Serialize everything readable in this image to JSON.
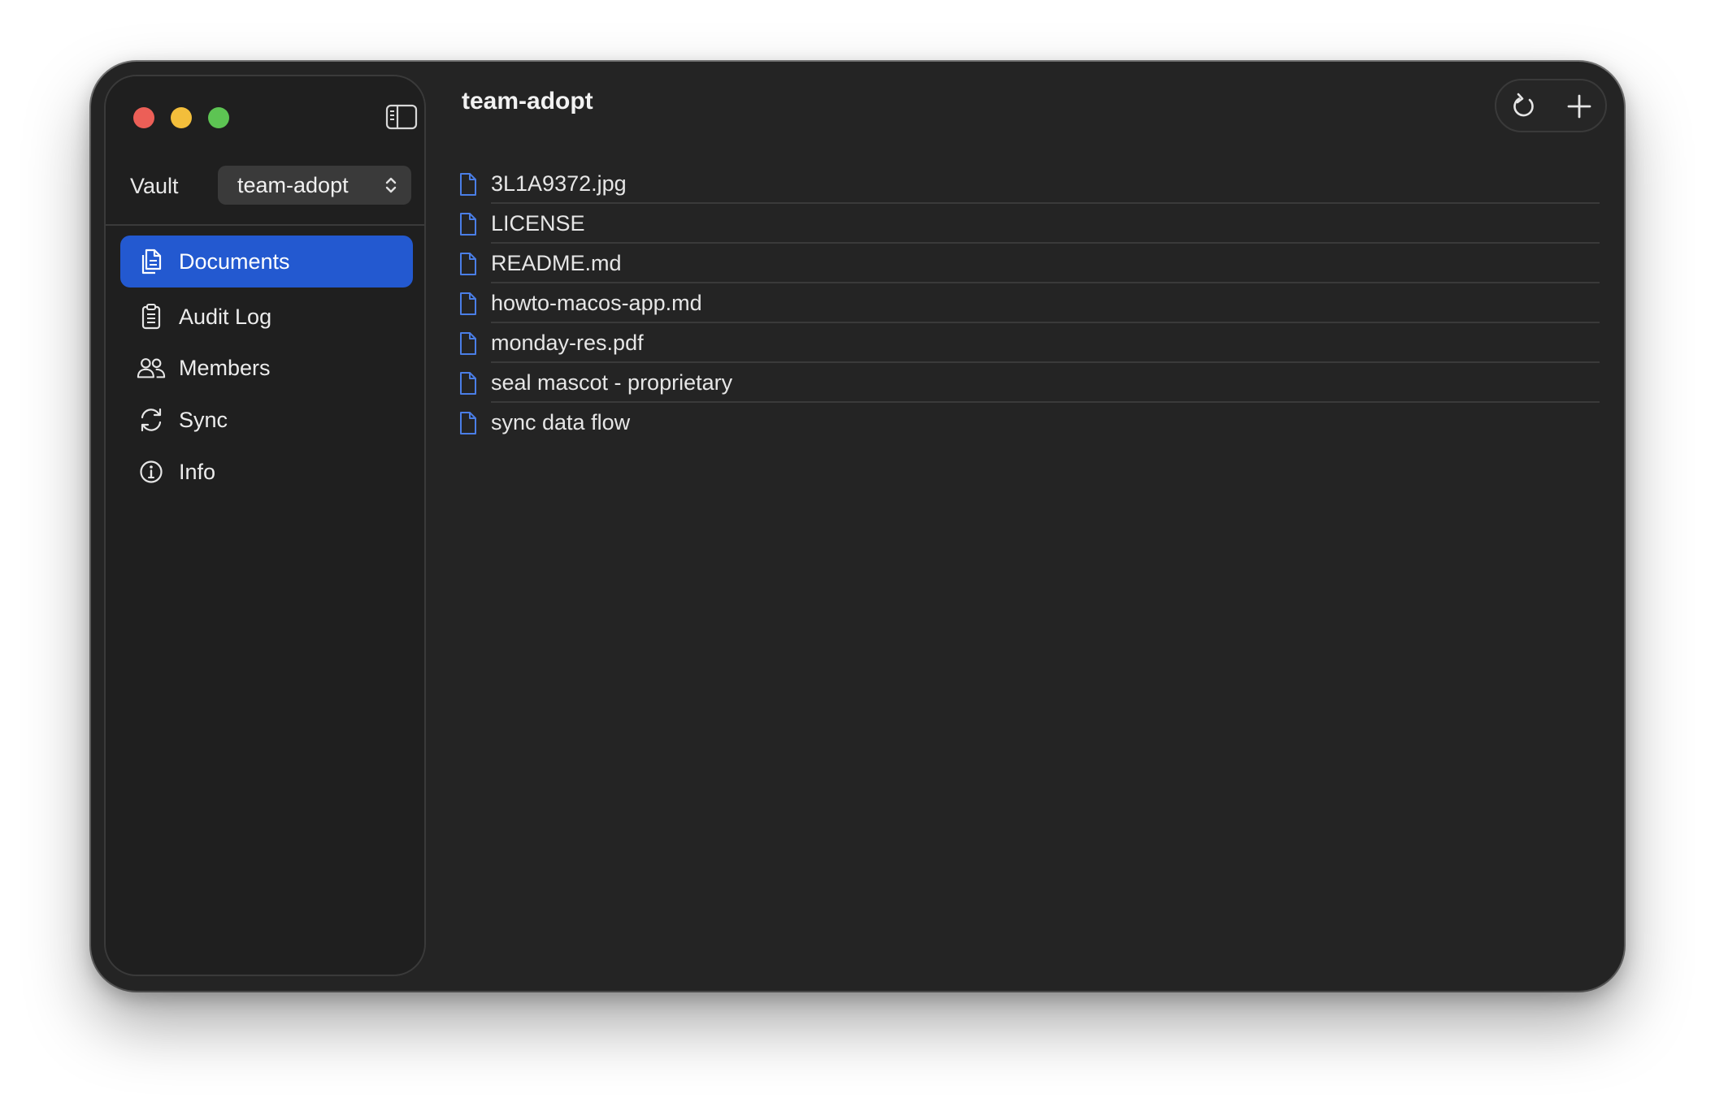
{
  "window": {
    "title": "team-adopt"
  },
  "sidebar": {
    "vault_label": "Vault",
    "vault_value": "team-adopt",
    "items": [
      {
        "label": "Documents",
        "icon": "documents-icon",
        "active": true
      },
      {
        "label": "Audit Log",
        "icon": "clipboard-icon",
        "active": false
      },
      {
        "label": "Members",
        "icon": "people-icon",
        "active": false
      },
      {
        "label": "Sync",
        "icon": "sync-icon",
        "active": false
      },
      {
        "label": "Info",
        "icon": "info-icon",
        "active": false
      }
    ]
  },
  "toolbar": {
    "refresh_icon": "refresh-icon",
    "add_icon": "plus-icon"
  },
  "files": [
    {
      "name": "3L1A9372.jpg"
    },
    {
      "name": "LICENSE"
    },
    {
      "name": "README.md"
    },
    {
      "name": "howto-macos-app.md"
    },
    {
      "name": "monday-res.pdf"
    },
    {
      "name": "seal mascot - proprietary"
    },
    {
      "name": "sync data flow"
    }
  ],
  "colors": {
    "accent": "#2359d0",
    "window_bg": "#242424",
    "sidebar_bg": "#1f1f1f",
    "file_icon": "#4a7ee6",
    "close": "#ec5f57",
    "minimize": "#f3be3b",
    "maximize": "#5dc453"
  }
}
